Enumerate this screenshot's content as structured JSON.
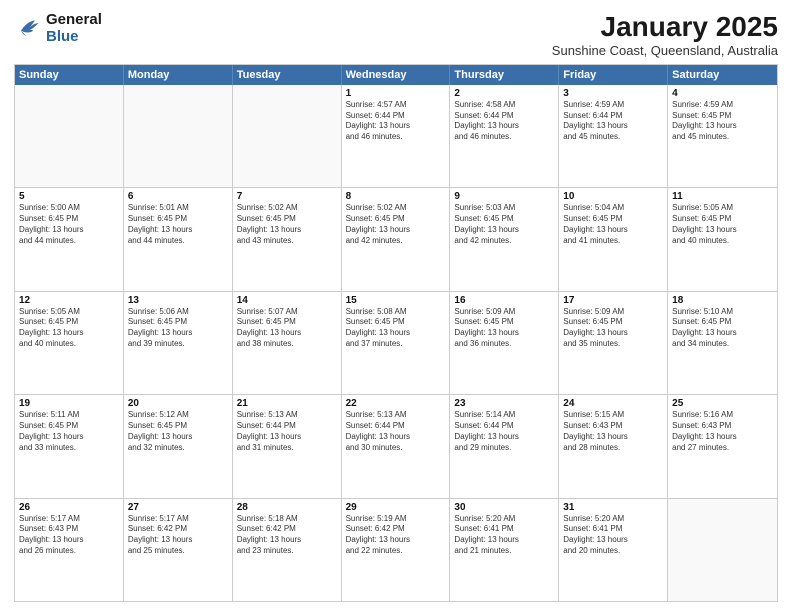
{
  "header": {
    "logo_line1": "General",
    "logo_line2": "Blue",
    "month": "January 2025",
    "location": "Sunshine Coast, Queensland, Australia"
  },
  "day_headers": [
    "Sunday",
    "Monday",
    "Tuesday",
    "Wednesday",
    "Thursday",
    "Friday",
    "Saturday"
  ],
  "weeks": [
    [
      {
        "num": "",
        "info": ""
      },
      {
        "num": "",
        "info": ""
      },
      {
        "num": "",
        "info": ""
      },
      {
        "num": "1",
        "info": "Sunrise: 4:57 AM\nSunset: 6:44 PM\nDaylight: 13 hours\nand 46 minutes."
      },
      {
        "num": "2",
        "info": "Sunrise: 4:58 AM\nSunset: 6:44 PM\nDaylight: 13 hours\nand 46 minutes."
      },
      {
        "num": "3",
        "info": "Sunrise: 4:59 AM\nSunset: 6:44 PM\nDaylight: 13 hours\nand 45 minutes."
      },
      {
        "num": "4",
        "info": "Sunrise: 4:59 AM\nSunset: 6:45 PM\nDaylight: 13 hours\nand 45 minutes."
      }
    ],
    [
      {
        "num": "5",
        "info": "Sunrise: 5:00 AM\nSunset: 6:45 PM\nDaylight: 13 hours\nand 44 minutes."
      },
      {
        "num": "6",
        "info": "Sunrise: 5:01 AM\nSunset: 6:45 PM\nDaylight: 13 hours\nand 44 minutes."
      },
      {
        "num": "7",
        "info": "Sunrise: 5:02 AM\nSunset: 6:45 PM\nDaylight: 13 hours\nand 43 minutes."
      },
      {
        "num": "8",
        "info": "Sunrise: 5:02 AM\nSunset: 6:45 PM\nDaylight: 13 hours\nand 42 minutes."
      },
      {
        "num": "9",
        "info": "Sunrise: 5:03 AM\nSunset: 6:45 PM\nDaylight: 13 hours\nand 42 minutes."
      },
      {
        "num": "10",
        "info": "Sunrise: 5:04 AM\nSunset: 6:45 PM\nDaylight: 13 hours\nand 41 minutes."
      },
      {
        "num": "11",
        "info": "Sunrise: 5:05 AM\nSunset: 6:45 PM\nDaylight: 13 hours\nand 40 minutes."
      }
    ],
    [
      {
        "num": "12",
        "info": "Sunrise: 5:05 AM\nSunset: 6:45 PM\nDaylight: 13 hours\nand 40 minutes."
      },
      {
        "num": "13",
        "info": "Sunrise: 5:06 AM\nSunset: 6:45 PM\nDaylight: 13 hours\nand 39 minutes."
      },
      {
        "num": "14",
        "info": "Sunrise: 5:07 AM\nSunset: 6:45 PM\nDaylight: 13 hours\nand 38 minutes."
      },
      {
        "num": "15",
        "info": "Sunrise: 5:08 AM\nSunset: 6:45 PM\nDaylight: 13 hours\nand 37 minutes."
      },
      {
        "num": "16",
        "info": "Sunrise: 5:09 AM\nSunset: 6:45 PM\nDaylight: 13 hours\nand 36 minutes."
      },
      {
        "num": "17",
        "info": "Sunrise: 5:09 AM\nSunset: 6:45 PM\nDaylight: 13 hours\nand 35 minutes."
      },
      {
        "num": "18",
        "info": "Sunrise: 5:10 AM\nSunset: 6:45 PM\nDaylight: 13 hours\nand 34 minutes."
      }
    ],
    [
      {
        "num": "19",
        "info": "Sunrise: 5:11 AM\nSunset: 6:45 PM\nDaylight: 13 hours\nand 33 minutes."
      },
      {
        "num": "20",
        "info": "Sunrise: 5:12 AM\nSunset: 6:45 PM\nDaylight: 13 hours\nand 32 minutes."
      },
      {
        "num": "21",
        "info": "Sunrise: 5:13 AM\nSunset: 6:44 PM\nDaylight: 13 hours\nand 31 minutes."
      },
      {
        "num": "22",
        "info": "Sunrise: 5:13 AM\nSunset: 6:44 PM\nDaylight: 13 hours\nand 30 minutes."
      },
      {
        "num": "23",
        "info": "Sunrise: 5:14 AM\nSunset: 6:44 PM\nDaylight: 13 hours\nand 29 minutes."
      },
      {
        "num": "24",
        "info": "Sunrise: 5:15 AM\nSunset: 6:43 PM\nDaylight: 13 hours\nand 28 minutes."
      },
      {
        "num": "25",
        "info": "Sunrise: 5:16 AM\nSunset: 6:43 PM\nDaylight: 13 hours\nand 27 minutes."
      }
    ],
    [
      {
        "num": "26",
        "info": "Sunrise: 5:17 AM\nSunset: 6:43 PM\nDaylight: 13 hours\nand 26 minutes."
      },
      {
        "num": "27",
        "info": "Sunrise: 5:17 AM\nSunset: 6:42 PM\nDaylight: 13 hours\nand 25 minutes."
      },
      {
        "num": "28",
        "info": "Sunrise: 5:18 AM\nSunset: 6:42 PM\nDaylight: 13 hours\nand 23 minutes."
      },
      {
        "num": "29",
        "info": "Sunrise: 5:19 AM\nSunset: 6:42 PM\nDaylight: 13 hours\nand 22 minutes."
      },
      {
        "num": "30",
        "info": "Sunrise: 5:20 AM\nSunset: 6:41 PM\nDaylight: 13 hours\nand 21 minutes."
      },
      {
        "num": "31",
        "info": "Sunrise: 5:20 AM\nSunset: 6:41 PM\nDaylight: 13 hours\nand 20 minutes."
      },
      {
        "num": "",
        "info": ""
      }
    ]
  ]
}
